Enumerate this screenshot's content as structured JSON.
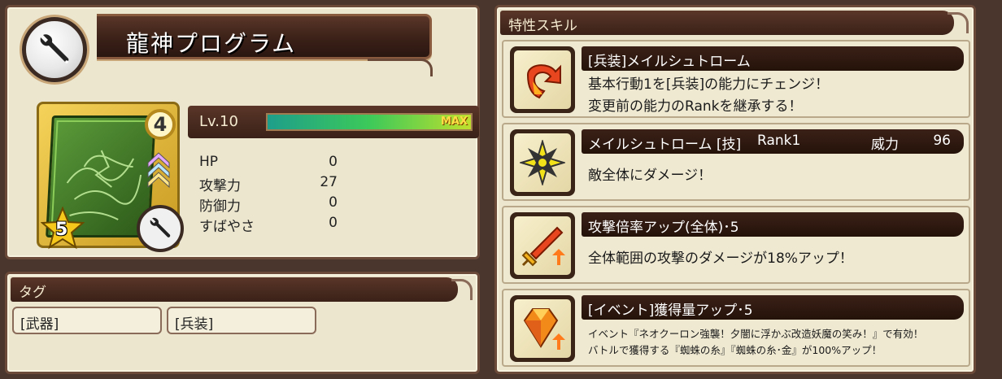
{
  "item": {
    "name": "龍神プログラム",
    "level_badge": "4",
    "star_count": "5",
    "level_label": "Lv.10",
    "exp_percent": 100,
    "exp_max_label": "MAX",
    "stats": [
      {
        "label": "HP",
        "value": "0"
      },
      {
        "label": "攻撃力",
        "value": "27"
      },
      {
        "label": "防御力",
        "value": "0"
      },
      {
        "label": "すばやさ",
        "value": "0"
      }
    ]
  },
  "tags": {
    "header": "タグ",
    "items": [
      "[武器]",
      "[兵装]"
    ]
  },
  "skills": {
    "header": "特性スキル",
    "items": [
      {
        "name": "[兵装]メイルシュトローム",
        "icon": "swap-arrow-icon",
        "rank": "",
        "power_label": "",
        "power_value": "",
        "desc": [
          "基本行動1を[兵装]の能力にチェンジ！",
          "変更前の能力のRankを継承する！"
        ]
      },
      {
        "name": "メイルシュトローム [技]",
        "icon": "shuriken-icon",
        "rank": "Rank1",
        "power_label": "威力",
        "power_value": "96",
        "desc": [
          "敵全体にダメージ！"
        ]
      },
      {
        "name": "攻撃倍率アップ(全体)･5",
        "icon": "sword-up-icon",
        "rank": "",
        "power_label": "",
        "power_value": "",
        "desc": [
          "全体範囲の攻撃のダメージが18%アップ！"
        ]
      },
      {
        "name": "[イベント]獲得量アップ･5",
        "icon": "gem-up-icon",
        "rank": "",
        "power_label": "",
        "power_value": "",
        "desc": [
          "イベント『ネオクーロン強襲！夕闇に浮かぶ改造妖魔の笑み！』で有効！",
          "バトルで獲得する『蜘蛛の糸』『蜘蛛の糸･金』が100%アップ！"
        ]
      }
    ]
  },
  "colors": {
    "panel_bg": "#ece6cf",
    "banner_dark": "#3a2118",
    "border": "#6b4a3a",
    "exp_green": "#3cc95a"
  }
}
